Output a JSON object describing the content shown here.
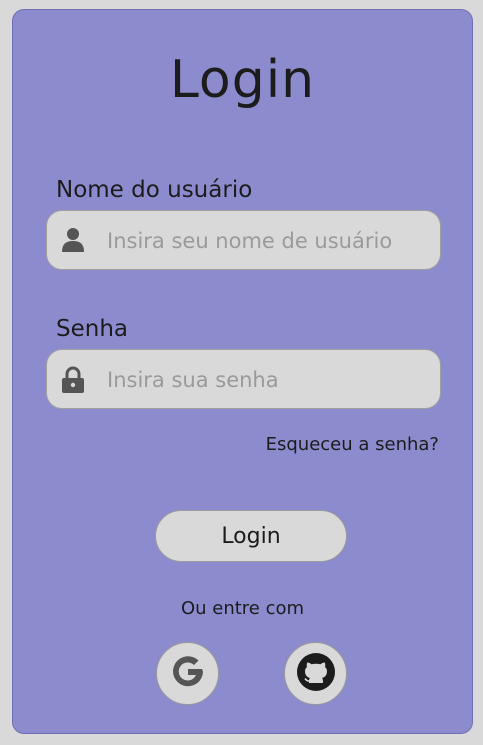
{
  "title": "Login",
  "username": {
    "label": "Nome do usuário",
    "placeholder": "Insira seu nome de usuário",
    "icon": "user-icon"
  },
  "password": {
    "label": "Senha",
    "placeholder": "Insira sua senha",
    "icon": "lock-icon"
  },
  "forgot_link": "Esqueceu a senha?",
  "login_button": "Login",
  "alt_login_text": "Ou entre com",
  "social": [
    {
      "name": "google",
      "icon": "google-icon"
    },
    {
      "name": "github",
      "icon": "github-icon"
    }
  ],
  "colors": {
    "card_bg": "#8b8bce",
    "page_bg": "#d9d9d9",
    "field_bg": "#d9d9d9",
    "text": "#1c1c1c",
    "icon": "#555555"
  }
}
